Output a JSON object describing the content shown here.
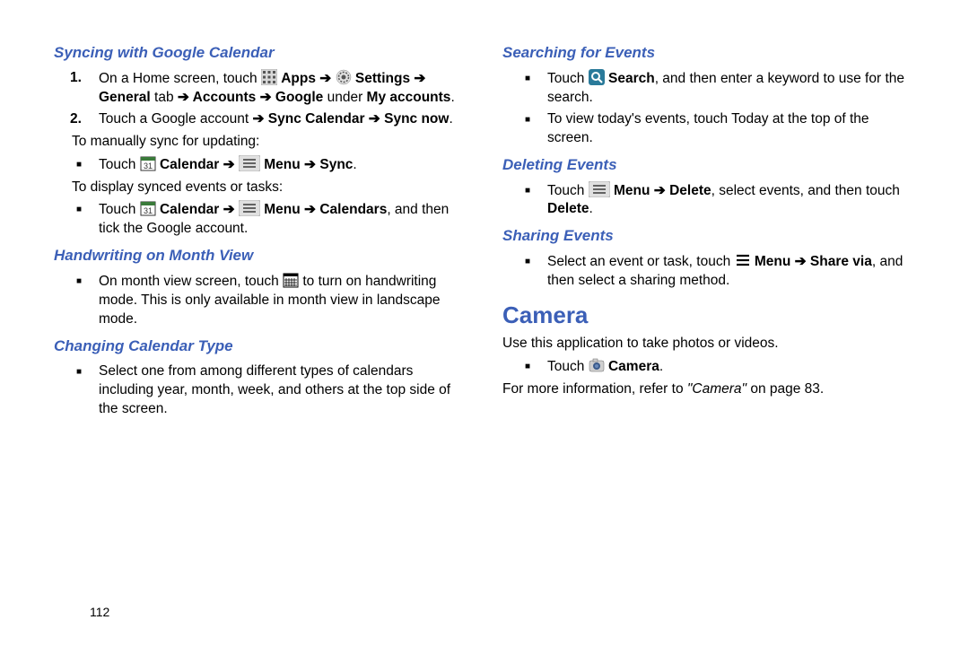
{
  "left": {
    "h1": "Syncing with Google Calendar",
    "step1_pre": "On a Home screen, touch ",
    "step1_apps": "Apps",
    "step1_settings": "Settings",
    "step1_line2a": "General",
    "step1_line2b": " tab ",
    "step1_line2c": "Accounts",
    "step1_line2d": "Google",
    "step1_line2e": " under ",
    "step1_line2f": "My accounts",
    "step2_pre": "Touch a Google account ",
    "step2_sync_cal": "Sync Calendar",
    "step2_sync_now": "Sync now",
    "para1": "To manually sync for updating:",
    "b1_pre": "Touch ",
    "b1_cal": "Calendar",
    "b1_menu": "Menu",
    "b1_sync": "Sync",
    "para2": "To display synced events or tasks:",
    "b2_pre": "Touch ",
    "b2_cal": "Calendar",
    "b2_menu": "Menu",
    "b2_cals": "Calendars",
    "b2_tail": ", and then tick the Google account.",
    "h2": "Handwriting on Month View",
    "b3_pre": "On month view screen, touch ",
    "b3_tail": " to turn on handwriting mode. This is only available in month view in landscape mode.",
    "h3": "Changing Calendar Type",
    "b4": "Select one from among different types of calendars including year, month, week, and others at the top side of the screen."
  },
  "right": {
    "h1": "Searching for Events",
    "b1_pre": "Touch ",
    "b1_search": "Search",
    "b1_tail": ", and then enter a keyword to use for the search.",
    "b2": "To view today's events, touch Today at the top of the screen.",
    "h2": "Deleting Events",
    "b3_pre": "Touch ",
    "b3_menu": "Menu",
    "b3_delete": "Delete",
    "b3_mid": ", select events, and then touch ",
    "b3_delete2": "Delete",
    "h3": "Sharing Events",
    "b4_pre": "Select an event or task, touch ",
    "b4_menu": "Menu",
    "b4_share": "Share via",
    "b4_tail": ", and then select a sharing method.",
    "sec": "Camera",
    "p1": "Use this application to take photos or videos.",
    "b5_pre": "Touch ",
    "b5_cam": "Camera",
    "p2_pre": "For more information, refer to ",
    "p2_ref": "\"Camera\"",
    "p2_tail": " on page 83."
  },
  "page": "112",
  "arrow": "➔"
}
